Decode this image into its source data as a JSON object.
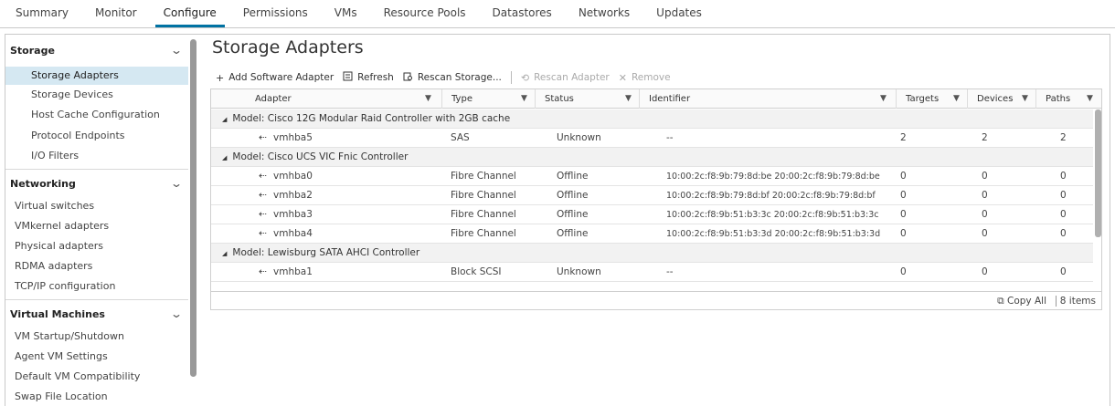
{
  "tabs": [
    "Summary",
    "Monitor",
    "Configure",
    "Permissions",
    "VMs",
    "Resource Pools",
    "Datastores",
    "Networks",
    "Updates"
  ],
  "active_tab": "Configure",
  "sidebar": {
    "storage": {
      "label": "Storage",
      "items": [
        "Storage Adapters",
        "Storage Devices",
        "Host Cache Configuration",
        "Protocol Endpoints",
        "I/O Filters"
      ]
    },
    "networking": {
      "label": "Networking",
      "items": [
        "Virtual switches",
        "VMkernel adapters",
        "Physical adapters",
        "RDMA adapters",
        "TCP/IP configuration"
      ]
    },
    "virtual_machines": {
      "label": "Virtual Machines",
      "items": [
        "VM Startup/Shutdown",
        "Agent VM Settings",
        "Default VM Compatibility",
        "Swap File Location"
      ]
    },
    "selected": "Storage Adapters"
  },
  "main": {
    "title": "Storage Adapters",
    "toolbar": {
      "add": "Add Software Adapter",
      "refresh": "Refresh",
      "rescan_storage": "Rescan Storage...",
      "rescan_adapter": "Rescan Adapter",
      "remove": "Remove"
    }
  },
  "table": {
    "columns": [
      "Adapter",
      "Type",
      "Status",
      "Identifier",
      "Targets",
      "Devices",
      "Paths"
    ],
    "groups": [
      {
        "label": "Model: Cisco 12G Modular Raid Controller with 2GB cache",
        "rows": [
          {
            "adapter": "vmhba5",
            "type": "SAS",
            "status": "Unknown",
            "identifier": "--",
            "targets": "2",
            "devices": "2",
            "paths": "2"
          }
        ]
      },
      {
        "label": "Model: Cisco UCS VIC Fnic Controller",
        "rows": [
          {
            "adapter": "vmhba0",
            "type": "Fibre Channel",
            "status": "Offline",
            "identifier": "10:00:2c:f8:9b:79:8d:be 20:00:2c:f8:9b:79:8d:be",
            "targets": "0",
            "devices": "0",
            "paths": "0"
          },
          {
            "adapter": "vmhba2",
            "type": "Fibre Channel",
            "status": "Offline",
            "identifier": "10:00:2c:f8:9b:79:8d:bf 20:00:2c:f8:9b:79:8d:bf",
            "targets": "0",
            "devices": "0",
            "paths": "0"
          },
          {
            "adapter": "vmhba3",
            "type": "Fibre Channel",
            "status": "Offline",
            "identifier": "10:00:2c:f8:9b:51:b3:3c 20:00:2c:f8:9b:51:b3:3c",
            "targets": "0",
            "devices": "0",
            "paths": "0"
          },
          {
            "adapter": "vmhba4",
            "type": "Fibre Channel",
            "status": "Offline",
            "identifier": "10:00:2c:f8:9b:51:b3:3d 20:00:2c:f8:9b:51:b3:3d",
            "targets": "0",
            "devices": "0",
            "paths": "0"
          }
        ]
      },
      {
        "label": "Model: Lewisburg SATA AHCI Controller",
        "rows": [
          {
            "adapter": "vmhba1",
            "type": "Block SCSI",
            "status": "Unknown",
            "identifier": "--",
            "targets": "0",
            "devices": "0",
            "paths": "0"
          }
        ]
      }
    ],
    "footer": {
      "copy_all": "Copy All",
      "count": "8 items"
    }
  },
  "colors": {
    "accent": "#0072a3",
    "selected_bg": "#d5e8f2",
    "group_bg": "#f2f2f2"
  }
}
